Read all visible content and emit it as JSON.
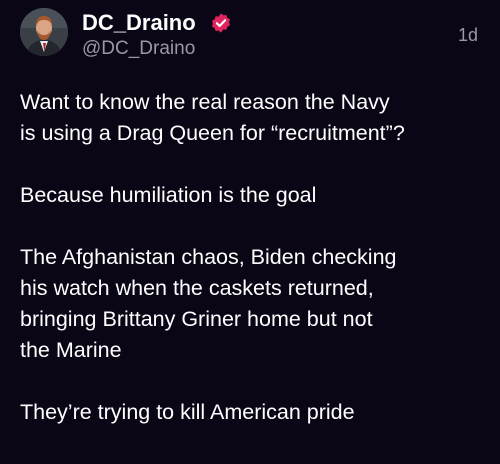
{
  "post": {
    "author": {
      "display_name": "DC_Draino",
      "handle": "@DC_Draino",
      "verified_icon": "verified-badge-icon",
      "verified_color": "#e0245e"
    },
    "timestamp": "1d",
    "paragraphs": [
      "Want to know the real reason the Navy\nis using a Drag Queen for “recruitment”?",
      "Because humiliation is the goal",
      "The Afghanistan chaos, Biden checking\nhis watch when the caskets returned,\nbringing Brittany Griner home but not\nthe Marine",
      "They’re trying to kill American pride"
    ]
  },
  "colors": {
    "background": "#0b0616",
    "text": "#ffffff",
    "secondary_text": "#9b97a6"
  }
}
